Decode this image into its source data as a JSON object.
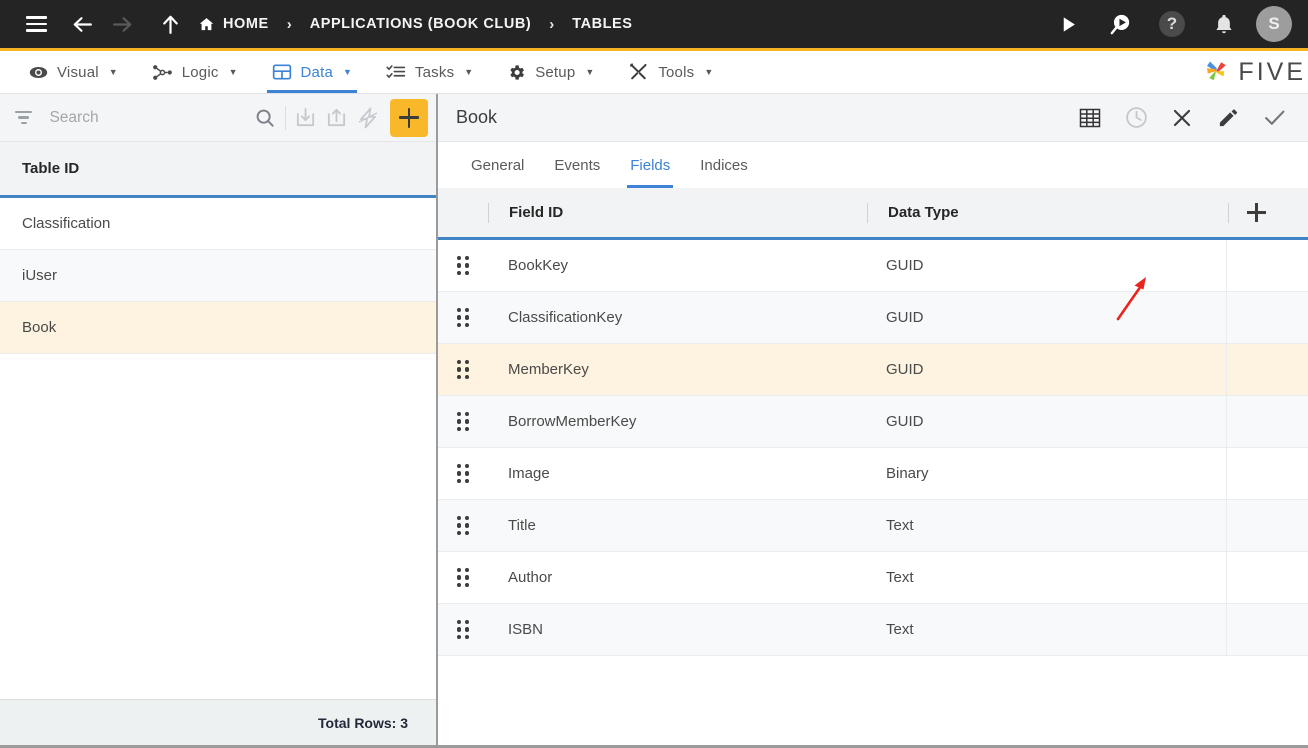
{
  "topbar": {
    "menu_icon": "hamburger-icon",
    "back_icon": "arrow-left-icon",
    "forward_icon": "arrow-right-icon",
    "up_icon": "arrow-up-icon",
    "breadcrumb": [
      {
        "label": "HOME",
        "icon": "home-icon"
      },
      {
        "label": "APPLICATIONS (BOOK CLUB)",
        "icon": ""
      },
      {
        "label": "TABLES",
        "icon": ""
      }
    ],
    "separator": "›",
    "actions": [
      {
        "name": "run-icon",
        "label": ""
      },
      {
        "name": "search-play-icon",
        "label": ""
      },
      {
        "name": "help-icon",
        "label": "?"
      },
      {
        "name": "notifications-bell-icon",
        "label": ""
      }
    ],
    "avatar_initial": "S",
    "bg_color": "#242424"
  },
  "menubar": {
    "accent_top_color": "#f5b324",
    "active_color": "#3c82d6",
    "caret": "▼",
    "items": [
      {
        "label": "Visual",
        "icon": "eye-icon",
        "active": false
      },
      {
        "label": "Logic",
        "icon": "logic-nodes-icon",
        "active": false
      },
      {
        "label": "Data",
        "icon": "data-grid-icon",
        "active": true
      },
      {
        "label": "Tasks",
        "icon": "tasks-checklist-icon",
        "active": false
      },
      {
        "label": "Setup",
        "icon": "gear-icon",
        "active": false
      },
      {
        "label": "Tools",
        "icon": "tools-icon",
        "active": false
      }
    ],
    "brand": "FIVE"
  },
  "sidebar": {
    "toolbar": {
      "filter_icon": "filter-icon",
      "search_placeholder": "Search",
      "search_value": "",
      "search_icon": "search-icon",
      "import_icon": "import-icon",
      "export_icon": "export-icon",
      "lightning_icon": "lightning-bolt-icon",
      "add_icon": "plus-icon",
      "add_button_color": "#f8b82a"
    },
    "column_header": "Table ID",
    "rows": [
      {
        "label": "Classification",
        "selected": false
      },
      {
        "label": "iUser",
        "selected": false
      },
      {
        "label": "Book",
        "selected": true
      }
    ],
    "footer": "Total Rows: 3"
  },
  "main": {
    "title": "Book",
    "header_actions": [
      {
        "name": "grid-view-icon",
        "state": "enabled"
      },
      {
        "name": "history-clock-icon",
        "state": "disabled"
      },
      {
        "name": "close-x-icon",
        "state": "enabled"
      },
      {
        "name": "edit-pencil-icon",
        "state": "enabled"
      },
      {
        "name": "confirm-check-icon",
        "state": "enabled"
      }
    ],
    "tabs": [
      {
        "label": "General",
        "active": false
      },
      {
        "label": "Events",
        "active": false
      },
      {
        "label": "Fields",
        "active": true
      },
      {
        "label": "Indices",
        "active": false
      }
    ],
    "grid": {
      "columns": [
        "Field ID",
        "Data Type"
      ],
      "add_column_icon": "plus-icon",
      "row_handle_icon": "drag-handle-icon",
      "rows": [
        {
          "field_id": "BookKey",
          "data_type": "GUID",
          "selected": false
        },
        {
          "field_id": "ClassificationKey",
          "data_type": "GUID",
          "selected": false
        },
        {
          "field_id": "MemberKey",
          "data_type": "GUID",
          "selected": true
        },
        {
          "field_id": "BorrowMemberKey",
          "data_type": "GUID",
          "selected": false
        },
        {
          "field_id": "Image",
          "data_type": "Binary",
          "selected": false
        },
        {
          "field_id": "Title",
          "data_type": "Text",
          "selected": false
        },
        {
          "field_id": "Author",
          "data_type": "Text",
          "selected": false
        },
        {
          "field_id": "ISBN",
          "data_type": "Text",
          "selected": false
        }
      ]
    }
  },
  "annotation": {
    "arrow_color": "#e8251f",
    "points_to": "Indices"
  }
}
